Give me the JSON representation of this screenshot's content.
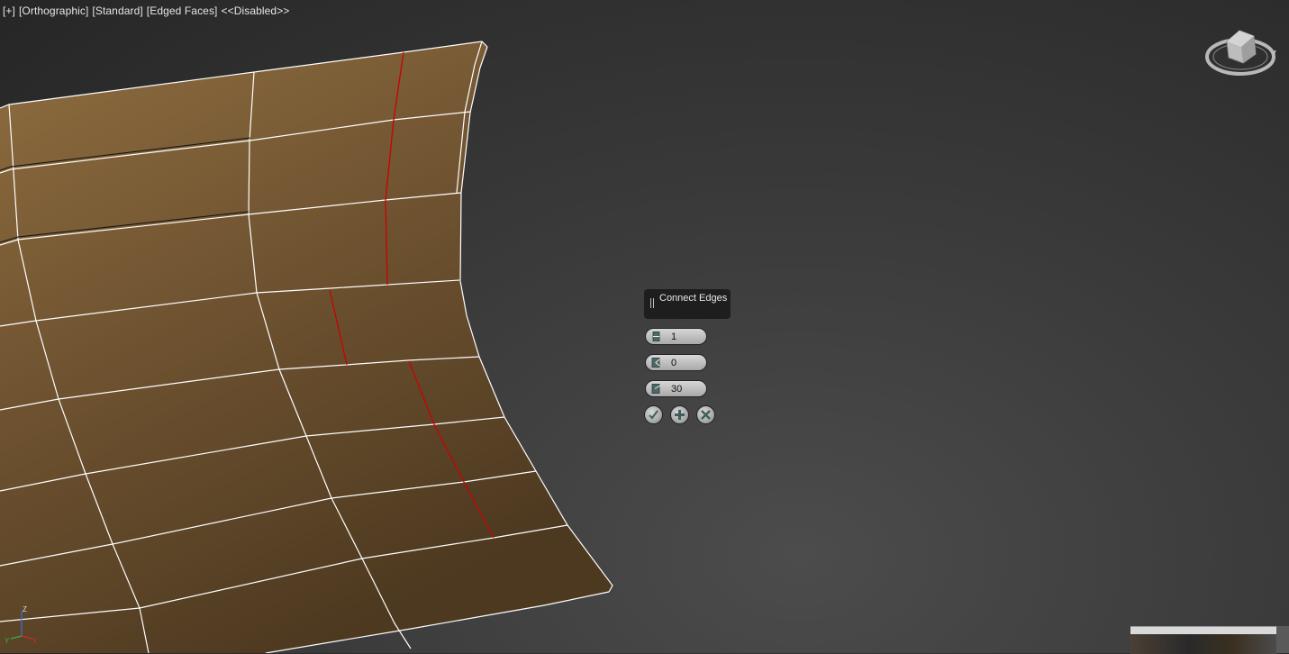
{
  "viewport": {
    "labels": [
      "[+]",
      "[Orthographic]",
      "[Standard]",
      "[Edged Faces]",
      "<<Disabled>>"
    ]
  },
  "caddy": {
    "title": "Connect Edges",
    "fields": [
      {
        "name": "segments",
        "value": "1"
      },
      {
        "name": "pinch",
        "value": "0"
      },
      {
        "name": "slide",
        "value": "30"
      }
    ],
    "buttons": [
      "ok",
      "apply-continue",
      "cancel"
    ]
  },
  "axis": {
    "z": "Z",
    "x": "X",
    "y": "Y"
  },
  "colors": {
    "mesh_face": "#8a6a3c",
    "mesh_edge": "#ffffff",
    "selected_edge": "#cc0000",
    "caddy_bg": "#1e1e1e"
  },
  "icons": [
    "viewcube-icon",
    "segments-icon",
    "pinch-icon",
    "slide-icon",
    "check-icon",
    "plus-icon",
    "close-icon"
  ]
}
